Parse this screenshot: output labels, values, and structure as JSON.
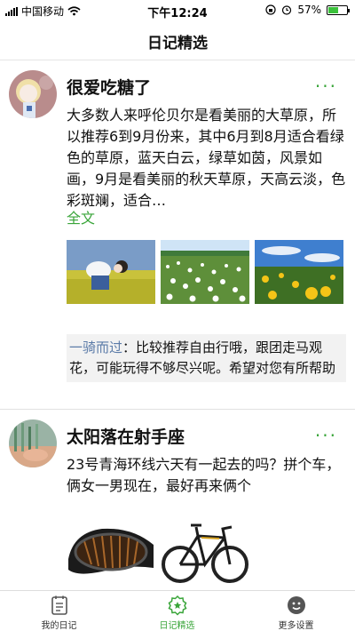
{
  "status_bar": {
    "carrier": "中国移动",
    "time": "下午12:24",
    "battery": "57%",
    "battery_level": 0.57
  },
  "nav": {
    "title": "日记精选"
  },
  "posts": [
    {
      "username": "很爱吃糖了",
      "more": "···",
      "text": "大多数人来呼伦贝尔是看美丽的大草原，所以推荐6到9月份来，其中6月到8月适合看绿色的草原，蓝天白云，绿草如茵，风景如画，9月是看美丽的秋天草原，天高云淡，色彩斑斓，适合…",
      "full_text_link": "全文",
      "photos": [
        "photo-girl-in-flower-field",
        "photo-white-flower-meadow",
        "photo-yellow-lilies"
      ],
      "comment": {
        "user": "一骑而过",
        "sep": "：",
        "text": "比较推荐自由行哦，跟团走马观花，可能玩得不够尽兴呢。希望对您有所帮助"
      }
    },
    {
      "username": "太阳落在射手座",
      "more": "···",
      "text": "23号青海环线六天有一起去的吗？拼个车，俩女一男现在，最好再来俩个",
      "photos": [
        "photo-motorcycle-goggles",
        "photo-mountain-bike"
      ]
    }
  ],
  "tabbar": {
    "tabs": [
      {
        "label": "我的日记",
        "icon": "diary-icon"
      },
      {
        "label": "日记精选",
        "icon": "featured-icon",
        "active": true
      },
      {
        "label": "更多设置",
        "icon": "settings-icon"
      }
    ]
  },
  "colors": {
    "accent": "#3aa53a",
    "comment_user": "#5b7ba8"
  }
}
